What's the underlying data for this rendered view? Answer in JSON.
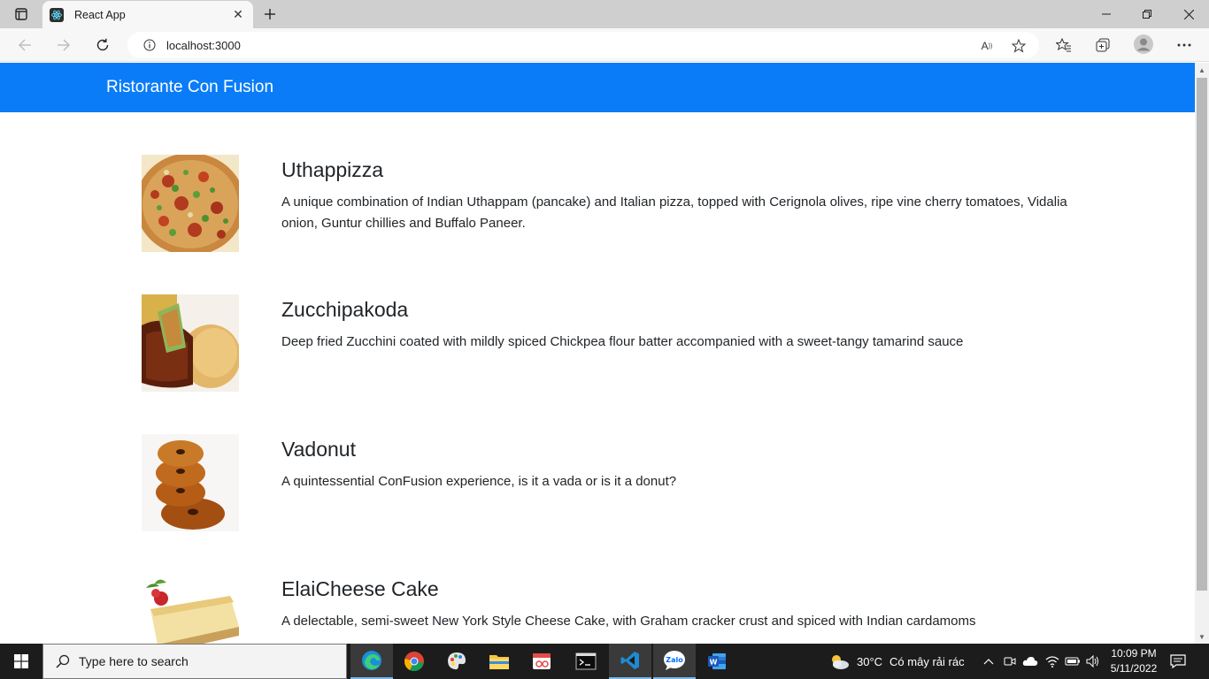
{
  "browser": {
    "tab_title": "React App",
    "url": "localhost:3000"
  },
  "navbar": {
    "brand": "Ristorante Con Fusion",
    "color": "#0a7cf7"
  },
  "dishes": [
    {
      "name": "Uthappizza",
      "description": "A unique combination of Indian Uthappam (pancake) and Italian pizza, topped with Cerignola olives, ripe vine cherry tomatoes, Vidalia onion, Guntur chillies and Buffalo Paneer."
    },
    {
      "name": "Zucchipakoda",
      "description": "Deep fried Zucchini coated with mildly spiced Chickpea flour batter accompanied with a sweet-tangy tamarind sauce"
    },
    {
      "name": "Vadonut",
      "description": "A quintessential ConFusion experience, is it a vada or is it a donut?"
    },
    {
      "name": "ElaiCheese Cake",
      "description": "A delectable, semi-sweet New York Style Cheese Cake, with Graham cracker crust and spiced with Indian cardamoms"
    }
  ],
  "taskbar": {
    "search_placeholder": "Type here to search",
    "weather_temp": "30°C",
    "weather_text": "Có mây rải rác",
    "time": "10:09 PM",
    "date": "5/11/2022"
  }
}
